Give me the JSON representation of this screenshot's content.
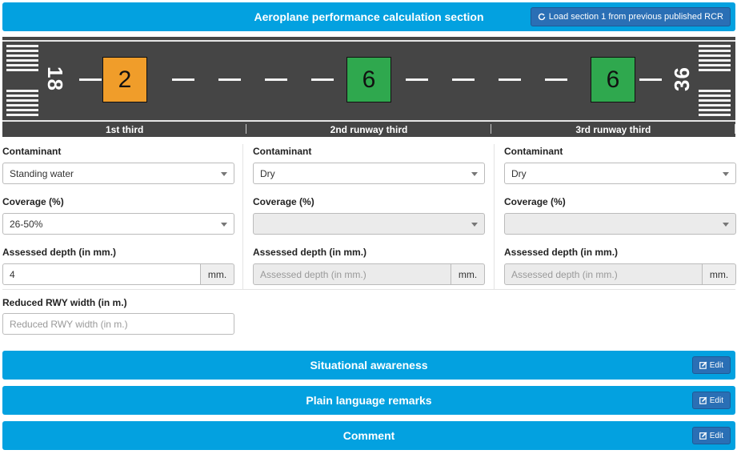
{
  "header": {
    "title": "Aeroplane performance calculation section",
    "load_button": "Load section 1 from previous published RCR"
  },
  "runway": {
    "left_designator": "18",
    "right_designator": "36",
    "codes": [
      "2",
      "6",
      "6"
    ],
    "code_colors": [
      "#f09d2a",
      "#2fa84e",
      "#2fa84e"
    ],
    "thirds": [
      "1st third",
      "2nd runway third",
      "3rd runway third"
    ]
  },
  "columns": [
    {
      "contaminant_label": "Contaminant",
      "contaminant_value": "Standing water",
      "coverage_label": "Coverage (%)",
      "coverage_value": "26-50%",
      "depth_label": "Assessed depth (in mm.)",
      "depth_value": "4",
      "depth_unit": "mm."
    },
    {
      "contaminant_label": "Contaminant",
      "contaminant_value": "Dry",
      "coverage_label": "Coverage (%)",
      "coverage_value": "",
      "depth_label": "Assessed depth (in mm.)",
      "depth_placeholder": "Assessed depth (in mm.)",
      "depth_unit": "mm."
    },
    {
      "contaminant_label": "Contaminant",
      "contaminant_value": "Dry",
      "coverage_label": "Coverage (%)",
      "coverage_value": "",
      "depth_label": "Assessed depth (in mm.)",
      "depth_placeholder": "Assessed depth (in mm.)",
      "depth_unit": "mm."
    }
  ],
  "reduced_width": {
    "label": "Reduced RWY width (in m.)",
    "placeholder": "Reduced RWY width (in m.)"
  },
  "sections": [
    {
      "title": "Situational awareness",
      "edit_label": "Edit"
    },
    {
      "title": "Plain language remarks",
      "edit_label": "Edit"
    },
    {
      "title": "Comment",
      "edit_label": "Edit"
    }
  ]
}
